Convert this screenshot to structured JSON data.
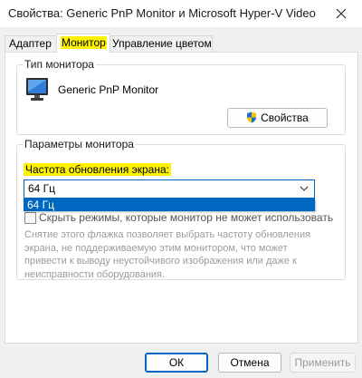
{
  "window": {
    "title": "Свойства: Generic PnP Monitor и Microsoft Hyper-V Video"
  },
  "tabs": [
    {
      "label": "Адаптер"
    },
    {
      "label": "Монитор"
    },
    {
      "label": "Управление цветом"
    }
  ],
  "monitor_type": {
    "group_label": "Тип монитора",
    "monitor_name": "Generic PnP Monitor",
    "properties_button": "Свойства"
  },
  "monitor_settings": {
    "group_label": "Параметры монитора",
    "refresh_label": "Частота обновления экрана:",
    "refresh_value": "64 Гц",
    "dropdown_options": [
      "64 Гц"
    ],
    "hide_modes_label": "Скрыть режимы, которые монитор не может использовать",
    "hide_modes_checked": false,
    "warning_text": "Снятие этого флажка позволяет выбрать частоту обновления экрана, не поддерживаемую этим монитором, что может привести к выводу неустойчивого изображения или даже к неисправности оборудования."
  },
  "footer": {
    "ok": "ОК",
    "cancel": "Отмена",
    "apply": "Применить"
  },
  "colors": {
    "highlight": "#fff200",
    "accent": "#0067c0"
  },
  "icons": {
    "monitor": "monitor-icon",
    "shield": "shield-icon",
    "close": "close-icon",
    "dropdown": "chevron-down-icon"
  }
}
